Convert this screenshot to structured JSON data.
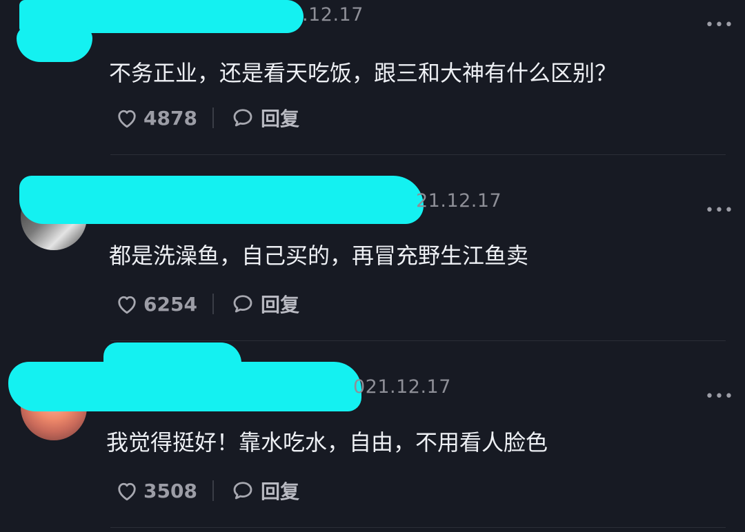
{
  "comments": [
    {
      "date": ".12.17",
      "text": "不务正业，还是看天吃饭，跟三和大神有什么区别？",
      "likes": "4878",
      "reply_label": "回复",
      "more": "•••"
    },
    {
      "date": "21.12.17",
      "text": "都是洗澡鱼，自己买的，再冒充野生江鱼卖",
      "likes": "6254",
      "reply_label": "回复",
      "more": "•••"
    },
    {
      "date": "021.12.17",
      "text": "我觉得挺好！靠水吃水，自由，不用看人脸色",
      "likes": "3508",
      "reply_label": "回复",
      "more": "•••"
    }
  ],
  "colors": {
    "background": "#171a23",
    "redaction": "#14f1f1",
    "muted_text": "#8e8f97"
  },
  "icons": {
    "like": "heart-outline-icon",
    "reply": "speech-bubble-icon",
    "more": "more-dots-icon"
  }
}
